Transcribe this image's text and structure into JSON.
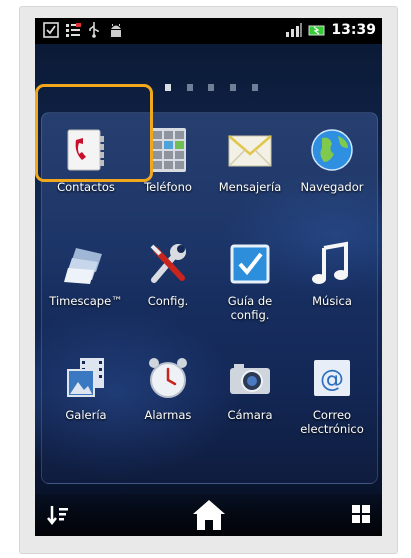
{
  "statusbar": {
    "time": "13:39",
    "icons": [
      "checkbox-notification-icon",
      "tasks-icon",
      "usb-icon",
      "android-debug-icon",
      "signal-icon",
      "battery-icon"
    ]
  },
  "pager": {
    "count": 5,
    "active": 0
  },
  "apps": [
    {
      "name": "app-contactos",
      "label": "Contactos",
      "icon": "contacts-icon"
    },
    {
      "name": "app-telefono",
      "label": "Teléfono",
      "icon": "phone-dialpad-icon"
    },
    {
      "name": "app-mensajeria",
      "label": "Mensajería",
      "icon": "envelope-icon"
    },
    {
      "name": "app-navegador",
      "label": "Navegador",
      "icon": "globe-icon"
    },
    {
      "name": "app-timescape",
      "label": "Timescape™",
      "icon": "timescape-icon"
    },
    {
      "name": "app-config",
      "label": "Config.",
      "icon": "tools-icon"
    },
    {
      "name": "app-guia-config",
      "label": "Guía de\nconfig.",
      "icon": "checkbox-icon"
    },
    {
      "name": "app-musica",
      "label": "Música",
      "icon": "music-note-icon"
    },
    {
      "name": "app-galeria",
      "label": "Galería",
      "icon": "gallery-icon"
    },
    {
      "name": "app-alarmas",
      "label": "Alarmas",
      "icon": "alarm-clock-icon"
    },
    {
      "name": "app-camara",
      "label": "Cámara",
      "icon": "camera-icon"
    },
    {
      "name": "app-correo",
      "label": "Correo\nelectrónico",
      "icon": "email-at-icon"
    }
  ],
  "bottombar": {
    "left_icon": "sort-icon",
    "center_icon": "home-icon",
    "right_icon": "grid-icon"
  },
  "colors": {
    "highlight": "#f2a81d",
    "panel": "#1e376e",
    "background": "#0b1a36"
  }
}
